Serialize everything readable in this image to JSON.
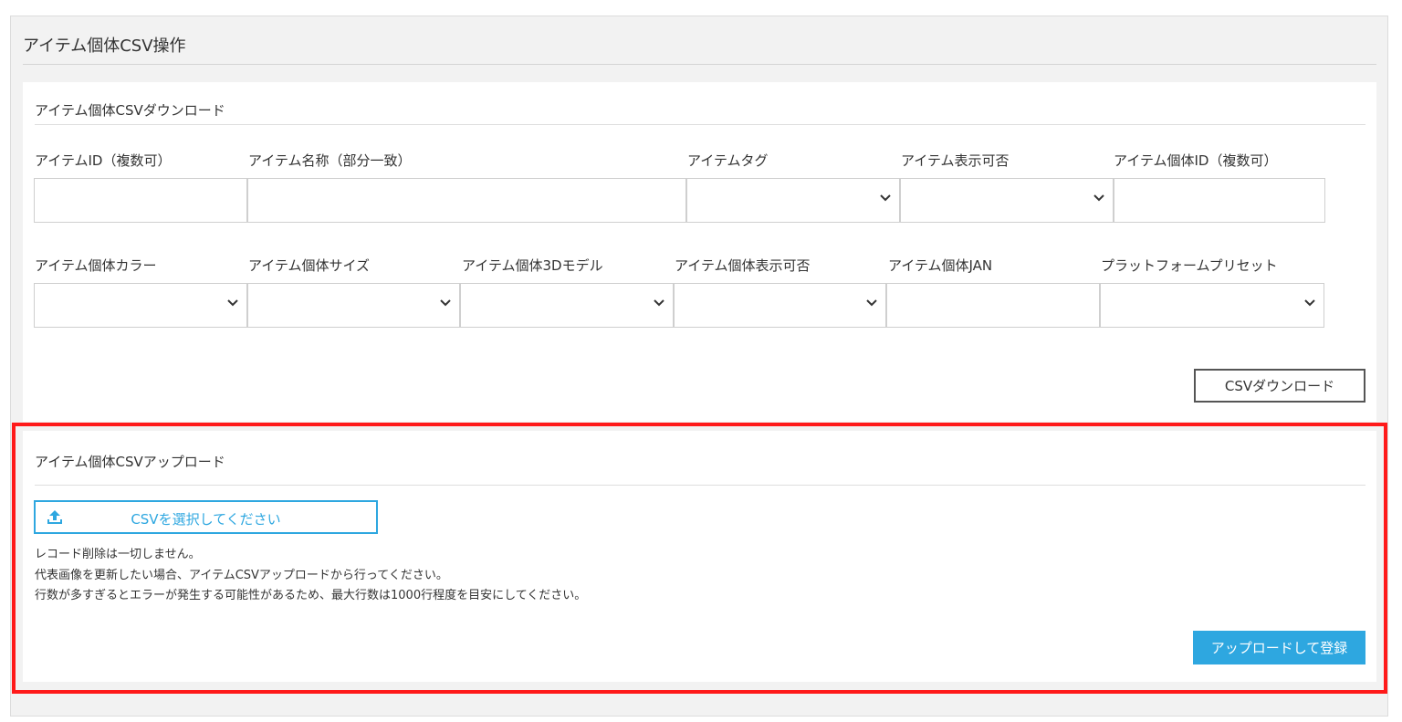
{
  "page": {
    "title": "アイテム個体CSV操作"
  },
  "download": {
    "section_title": "アイテム個体CSVダウンロード",
    "row1": {
      "item_id_label": "アイテムID（複数可）",
      "item_name_label": "アイテム名称（部分一致）",
      "item_tag_label": "アイテムタグ",
      "item_visibility_label": "アイテム表示可否",
      "unit_id_label": "アイテム個体ID（複数可）"
    },
    "row2": {
      "unit_color_label": "アイテム個体カラー",
      "unit_size_label": "アイテム個体サイズ",
      "unit_3d_model_label": "アイテム個体3Dモデル",
      "unit_visibility_label": "アイテム個体表示可否",
      "unit_jan_label": "アイテム個体JAN",
      "platform_preset_label": "プラットフォームプリセット"
    },
    "download_button": "CSVダウンロード"
  },
  "upload": {
    "section_title": "アイテム個体CSVアップロード",
    "file_button": "CSVを選択してください",
    "notes": [
      "レコード削除は一切しません。",
      "代表画像を更新したい場合、アイテムCSVアップロードから行ってください。",
      "行数が多すぎるとエラーが発生する可能性があるため、最大行数は1000行程度を目安にしてください。"
    ],
    "submit_button": "アップロードして登録"
  },
  "icons": {
    "select_arrow": "chevron-down-icon",
    "upload": "upload-icon"
  },
  "colors": {
    "accent": "#2ea7e0",
    "highlight": "#ff1a1a"
  }
}
